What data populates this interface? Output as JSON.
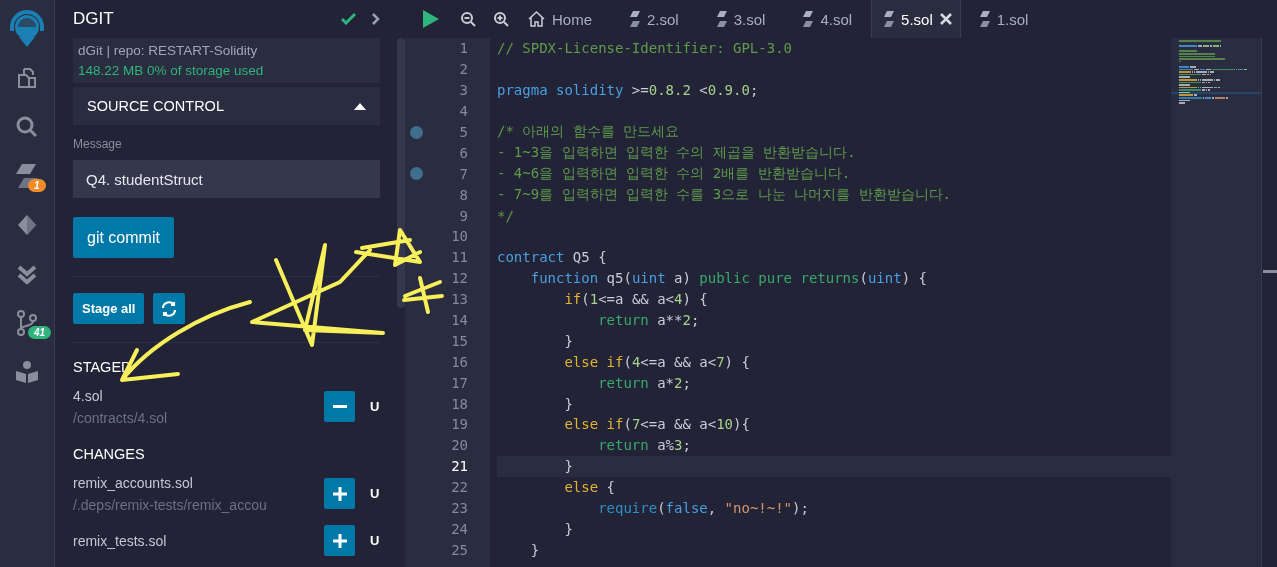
{
  "sidebar_icons": [
    {
      "kind": "logo"
    },
    {
      "kind": "files"
    },
    {
      "kind": "search"
    },
    {
      "kind": "compiler",
      "badge": {
        "text": "1",
        "color": "#f28c28"
      }
    },
    {
      "kind": "deploy"
    },
    {
      "kind": "tests"
    },
    {
      "kind": "git",
      "badge": {
        "text": "41",
        "color": "#2fb47c"
      }
    },
    {
      "kind": "learn"
    }
  ],
  "panel": {
    "title": "DGIT",
    "repo": "dGit | repo: RESTART-Solidity",
    "storage": "148.22 MB 0% of storage used",
    "section": {
      "title": "SOURCE CONTROL",
      "expanded": true
    },
    "message_label": "Message",
    "message_value": "Q4. studentStruct",
    "commit_button": "git commit",
    "stage_all_button": "Stage all",
    "groups": [
      {
        "title": "STAGED",
        "files": [
          {
            "name": "4.sol",
            "path": "/contracts/4.sol",
            "staged": true,
            "status": "U"
          }
        ]
      },
      {
        "title": "CHANGES",
        "files": [
          {
            "name": "remix_accounts.sol",
            "path": "/.deps/remix-tests/remix_accou",
            "staged": false,
            "status": "U"
          },
          {
            "name": "remix_tests.sol",
            "staged": false,
            "status": "U"
          }
        ]
      }
    ]
  },
  "tabs": [
    {
      "kind": "home",
      "label": "Home",
      "selected": false
    },
    {
      "kind": "file",
      "label": "2.sol",
      "selected": false
    },
    {
      "kind": "file",
      "label": "3.sol",
      "selected": false
    },
    {
      "kind": "file",
      "label": "4.sol",
      "selected": false
    },
    {
      "kind": "file",
      "label": "5.sol",
      "selected": true
    },
    {
      "kind": "file",
      "label": "1.sol",
      "selected": false
    }
  ],
  "editor": {
    "lines": [
      {
        "number": "1",
        "breakpoint": false,
        "current": false,
        "tokens": [
          {
            "t": "// SPDX-License-Identifier: GPL-3.0",
            "kind": "comment"
          }
        ]
      },
      {
        "number": "2",
        "breakpoint": false,
        "current": false
      },
      {
        "number": "3",
        "breakpoint": false,
        "current": false,
        "tokens": [
          {
            "t": "pragma solidity",
            "kind": "keyword"
          },
          {
            "t": " >=",
            "kind": "plain"
          },
          {
            "t": "0.8.2",
            "kind": "number"
          },
          {
            "t": " <",
            "kind": "plain"
          },
          {
            "t": "0.9.0",
            "kind": "number"
          },
          {
            "t": ";",
            "kind": "plain"
          }
        ]
      },
      {
        "number": "4",
        "breakpoint": false,
        "current": false
      },
      {
        "number": "5",
        "breakpoint": true,
        "current": false,
        "tokens": [
          {
            "t": "/* 아래의 함수를 만드세요",
            "kind": "comment"
          }
        ]
      },
      {
        "number": "6",
        "breakpoint": false,
        "current": false,
        "tokens": [
          {
            "t": "- 1~3을 입력하면 입력한 수의 제곱을 반환받습니다.",
            "kind": "comment"
          }
        ]
      },
      {
        "number": "7",
        "breakpoint": true,
        "current": false,
        "tokens": [
          {
            "t": "- 4~6을 입력하면 입력한 수의 2배를 반환받습니다.",
            "kind": "comment"
          }
        ]
      },
      {
        "number": "8",
        "breakpoint": false,
        "current": false,
        "tokens": [
          {
            "t": "- 7~9를 입력하면 입력한 수를 3으로 나눈 나머지를 반환받습니다.",
            "kind": "comment"
          }
        ]
      },
      {
        "number": "9",
        "breakpoint": false,
        "current": false,
        "tokens": [
          {
            "t": "*/",
            "kind": "comment"
          }
        ]
      },
      {
        "number": "10",
        "breakpoint": false,
        "current": false
      },
      {
        "number": "11",
        "breakpoint": false,
        "current": false,
        "tokens": [
          {
            "t": "contract",
            "kind": "keyword"
          },
          {
            "t": " Q5 {",
            "kind": "plain"
          }
        ]
      },
      {
        "number": "12",
        "breakpoint": false,
        "current": false,
        "tokens": [
          {
            "t": "    function",
            "kind": "keyword"
          },
          {
            "t": " q5(",
            "kind": "plain"
          },
          {
            "t": "uint",
            "kind": "keyword"
          },
          {
            "t": " a) ",
            "kind": "plain"
          },
          {
            "t": "public pure returns",
            "kind": "builtin"
          },
          {
            "t": "(",
            "kind": "plain"
          },
          {
            "t": "uint",
            "kind": "keyword"
          },
          {
            "t": ") {",
            "kind": "plain"
          }
        ]
      },
      {
        "number": "13",
        "breakpoint": false,
        "current": false,
        "tokens": [
          {
            "t": "        if",
            "kind": "control"
          },
          {
            "t": "(",
            "kind": "plain"
          },
          {
            "t": "1",
            "kind": "number"
          },
          {
            "t": "<=a && a<",
            "kind": "plain"
          },
          {
            "t": "4",
            "kind": "number"
          },
          {
            "t": ") {",
            "kind": "plain"
          }
        ]
      },
      {
        "number": "14",
        "breakpoint": false,
        "current": false,
        "tokens": [
          {
            "t": "            return",
            "kind": "builtin"
          },
          {
            "t": " a**",
            "kind": "plain"
          },
          {
            "t": "2",
            "kind": "number"
          },
          {
            "t": ";",
            "kind": "plain"
          }
        ]
      },
      {
        "number": "15",
        "breakpoint": false,
        "current": false,
        "tokens": [
          {
            "t": "        }",
            "kind": "plain"
          }
        ]
      },
      {
        "number": "16",
        "breakpoint": false,
        "current": false,
        "tokens": [
          {
            "t": "        else if",
            "kind": "control"
          },
          {
            "t": "(",
            "kind": "plain"
          },
          {
            "t": "4",
            "kind": "number"
          },
          {
            "t": "<=a && a<",
            "kind": "plain"
          },
          {
            "t": "7",
            "kind": "number"
          },
          {
            "t": ") {",
            "kind": "plain"
          }
        ]
      },
      {
        "number": "17",
        "breakpoint": false,
        "current": false,
        "tokens": [
          {
            "t": "            return",
            "kind": "builtin"
          },
          {
            "t": " a*",
            "kind": "plain"
          },
          {
            "t": "2",
            "kind": "number"
          },
          {
            "t": ";",
            "kind": "plain"
          }
        ]
      },
      {
        "number": "18",
        "breakpoint": false,
        "current": false,
        "tokens": [
          {
            "t": "        }",
            "kind": "plain"
          }
        ]
      },
      {
        "number": "19",
        "breakpoint": false,
        "current": false,
        "tokens": [
          {
            "t": "        else if",
            "kind": "control"
          },
          {
            "t": "(",
            "kind": "plain"
          },
          {
            "t": "7",
            "kind": "number"
          },
          {
            "t": "<=a && a<",
            "kind": "plain"
          },
          {
            "t": "10",
            "kind": "number"
          },
          {
            "t": "){",
            "kind": "plain"
          }
        ]
      },
      {
        "number": "20",
        "breakpoint": false,
        "current": false,
        "tokens": [
          {
            "t": "            return",
            "kind": "builtin"
          },
          {
            "t": " a%",
            "kind": "plain"
          },
          {
            "t": "3",
            "kind": "number"
          },
          {
            "t": ";",
            "kind": "plain"
          }
        ]
      },
      {
        "number": "21",
        "breakpoint": false,
        "current": true,
        "tokens": [
          {
            "t": "        }",
            "kind": "plain"
          }
        ]
      },
      {
        "number": "22",
        "breakpoint": false,
        "current": false,
        "tokens": [
          {
            "t": "        else",
            "kind": "control"
          },
          {
            "t": " {",
            "kind": "plain"
          }
        ]
      },
      {
        "number": "23",
        "breakpoint": false,
        "current": false,
        "tokens": [
          {
            "t": "            require",
            "kind": "function"
          },
          {
            "t": "(",
            "kind": "plain"
          },
          {
            "t": "false",
            "kind": "keyword"
          },
          {
            "t": ", ",
            "kind": "plain"
          },
          {
            "t": "\"no~!~!\"",
            "kind": "string"
          },
          {
            "t": ");",
            "kind": "plain"
          }
        ]
      },
      {
        "number": "24",
        "breakpoint": false,
        "current": false,
        "tokens": [
          {
            "t": "        }",
            "kind": "plain"
          }
        ]
      },
      {
        "number": "25",
        "breakpoint": false,
        "current": false,
        "tokens": [
          {
            "t": "    }",
            "kind": "plain"
          }
        ]
      }
    ]
  }
}
